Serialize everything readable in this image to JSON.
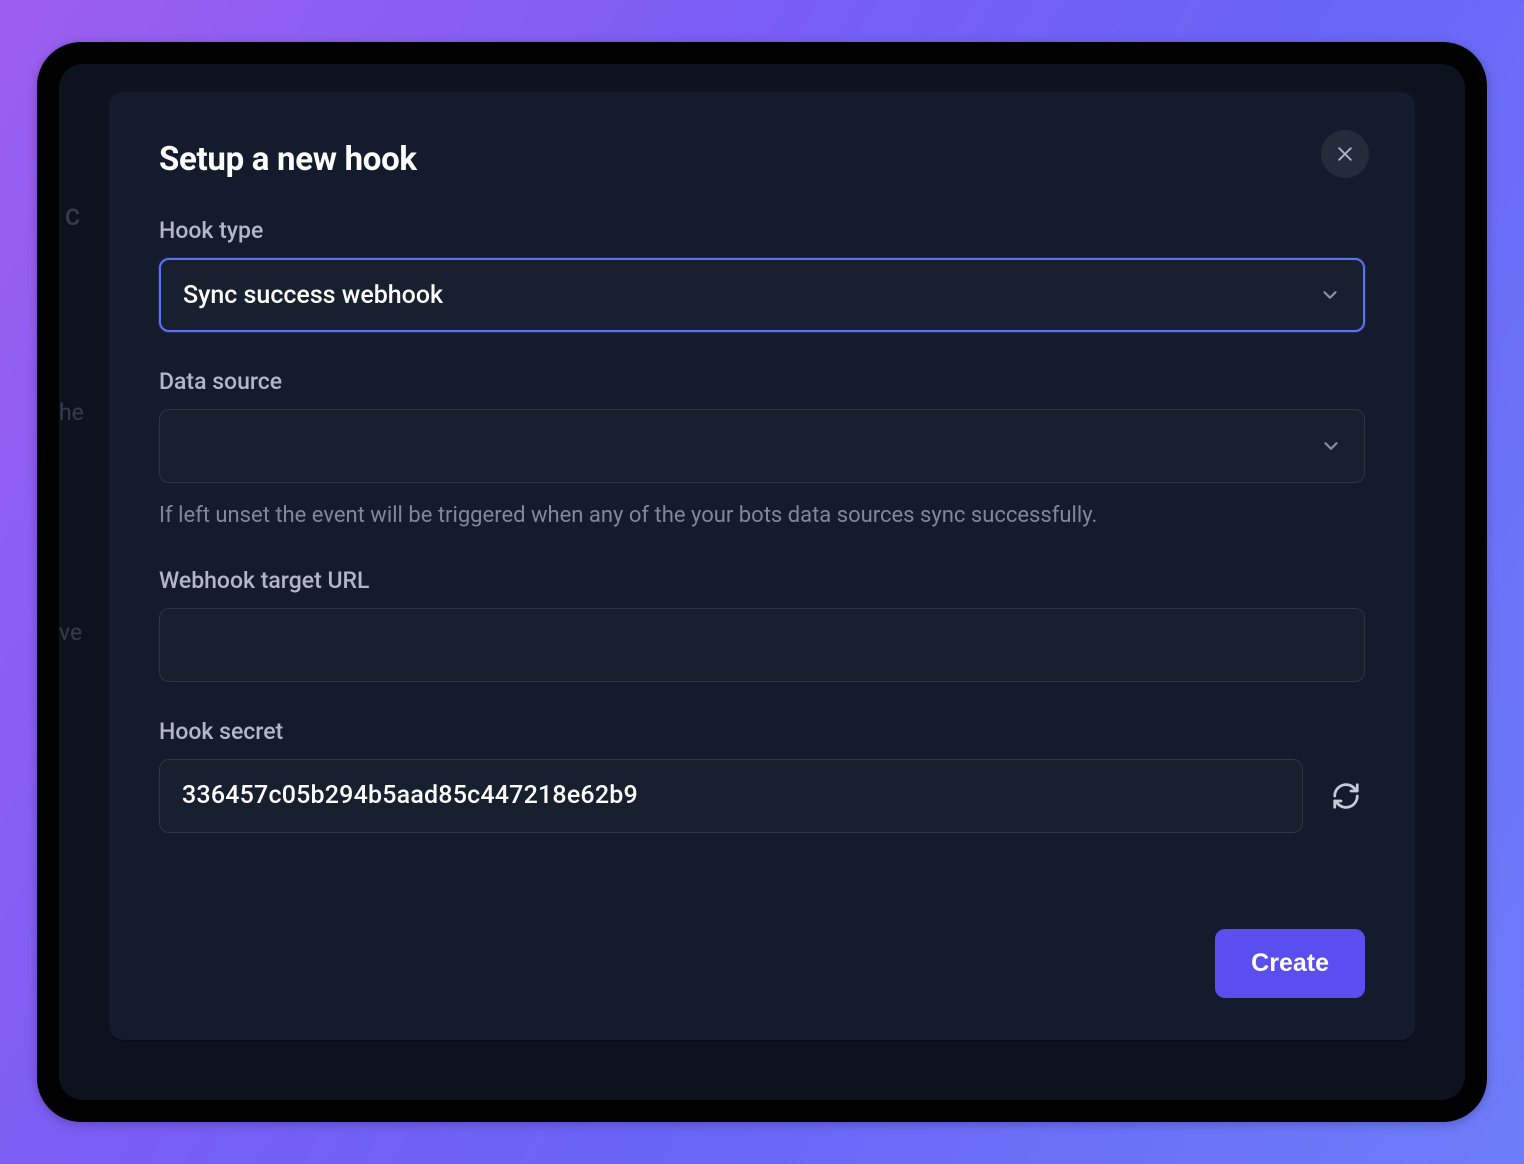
{
  "modal": {
    "title": "Setup a new hook",
    "fields": {
      "hook_type": {
        "label": "Hook type",
        "value": "Sync success webhook"
      },
      "data_source": {
        "label": "Data source",
        "value": "",
        "helper": "If left unset the event will be triggered when any of the your bots data sources sync successfully."
      },
      "target_url": {
        "label": "Webhook target URL",
        "value": ""
      },
      "secret": {
        "label": "Hook secret",
        "value": "336457c05b294b5aad85c447218e62b9"
      }
    },
    "create_label": "Create"
  },
  "background_hints": {
    "a": "C",
    "b": "he",
    "c": "ve"
  }
}
